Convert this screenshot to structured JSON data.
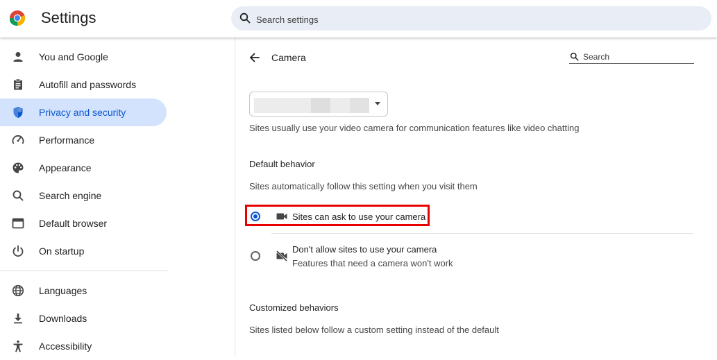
{
  "header": {
    "app_title": "Settings",
    "search_placeholder": "Search settings",
    "logo_icon": "chrome-logo-icon",
    "search_icon": "search-icon"
  },
  "sidebar": {
    "items": [
      {
        "label": "You and Google",
        "icon": "person-icon"
      },
      {
        "label": "Autofill and passwords",
        "icon": "clipboard-icon"
      },
      {
        "label": "Privacy and security",
        "icon": "shield-icon",
        "active": true
      },
      {
        "label": "Performance",
        "icon": "speedometer-icon"
      },
      {
        "label": "Appearance",
        "icon": "palette-icon"
      },
      {
        "label": "Search engine",
        "icon": "search-icon"
      },
      {
        "label": "Default browser",
        "icon": "browser-window-icon"
      },
      {
        "label": "On startup",
        "icon": "power-icon"
      },
      {
        "label": "Languages",
        "icon": "globe-icon"
      },
      {
        "label": "Downloads",
        "icon": "download-icon"
      },
      {
        "label": "Accessibility",
        "icon": "accessibility-icon"
      }
    ]
  },
  "page": {
    "title": "Camera",
    "search_placeholder": "Search",
    "description": "Sites usually use your video camera for communication features like video chatting",
    "default_behavior": {
      "title": "Default behavior",
      "description": "Sites automatically follow this setting when you visit them",
      "options": [
        {
          "label": "Sites can ask to use your camera",
          "icon": "video-camera-icon",
          "selected": true
        },
        {
          "label": "Don't allow sites to use your camera",
          "sublabel": "Features that need a camera won't work",
          "icon": "video-camera-off-icon",
          "selected": false
        }
      ]
    },
    "customized_behaviors": {
      "title": "Customized behaviors",
      "description": "Sites listed below follow a custom setting instead of the default"
    }
  },
  "colors": {
    "accent": "#0b57d0",
    "active_nav_bg": "#d3e3fd",
    "highlight": "#e60000",
    "search_bg": "#e9eef6"
  }
}
